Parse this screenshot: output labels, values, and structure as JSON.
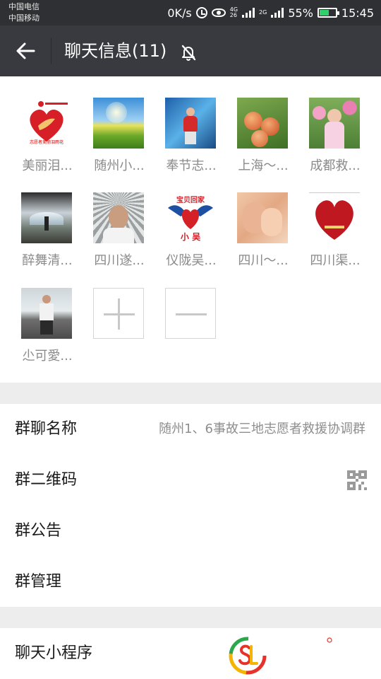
{
  "status_bar": {
    "carrier1": "中国电信",
    "carrier2": "中国移动",
    "speed": "0K/s",
    "net1": "4G",
    "net2": "26",
    "net3": "2G",
    "battery": "55%",
    "time": "15:45"
  },
  "header": {
    "title": "聊天信息(11)"
  },
  "members": [
    {
      "name": "美丽泪..."
    },
    {
      "name": "随州小..."
    },
    {
      "name": "奉节志..."
    },
    {
      "name": "上海～..."
    },
    {
      "name": "成都救..."
    },
    {
      "name": "醉舞清..."
    },
    {
      "name": "四川遂..."
    },
    {
      "name": "仪陇吴..."
    },
    {
      "name": "四川～..."
    },
    {
      "name": "四川渠..."
    },
    {
      "name": "尐可愛..."
    }
  ],
  "avatar_texts": {
    "a1_caption": "志愿者美丽泪雨花",
    "a8_top": "宝贝回家",
    "a8_bottom": "小 吴"
  },
  "settings": {
    "group_name_label": "群聊名称",
    "group_name_value": "随州1、6事故三地志愿者救援协调群",
    "qr_label": "群二维码",
    "notice_label": "群公告",
    "manage_label": "群管理",
    "mini_program_label": "聊天小程序"
  },
  "colors": {
    "status_bar_bg": "#2f3033",
    "titlebar_bg": "#393a3f",
    "page_bg": "#ededed",
    "battery_fill": "#2fd16a"
  }
}
